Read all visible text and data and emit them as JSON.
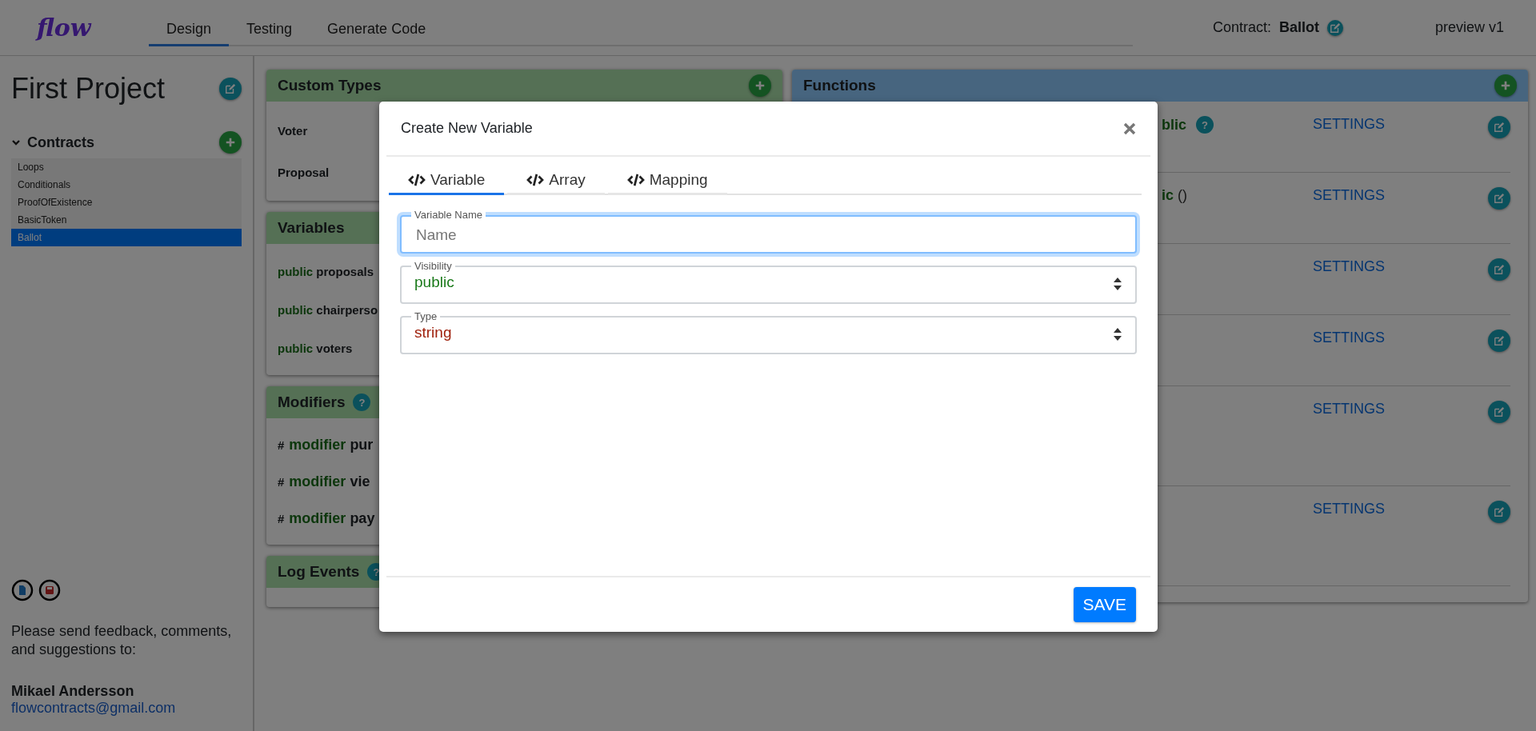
{
  "header": {
    "logo": "flow",
    "tabs": [
      {
        "label": "Design",
        "selected": true
      },
      {
        "label": "Testing",
        "selected": false
      },
      {
        "label": "Generate Code",
        "selected": false
      }
    ],
    "contract_label": "Contract:",
    "contract_name": "Ballot",
    "version": "preview v1"
  },
  "sidebar": {
    "project_title": "First Project",
    "contracts": {
      "title": "Contracts",
      "expanded": true,
      "items": [
        {
          "label": "Loops",
          "selected": false
        },
        {
          "label": "Conditionals",
          "selected": false
        },
        {
          "label": "ProofOfExistence",
          "selected": false
        },
        {
          "label": "BasicToken",
          "selected": false
        },
        {
          "label": "Ballot",
          "selected": true
        }
      ]
    },
    "feedback_text": "Please send feedback, comments, and suggestions to:",
    "author": "Mikael Andersson",
    "email": "flowcontracts@gmail.com"
  },
  "custom_types": {
    "title": "Custom Types",
    "items": [
      "Voter",
      "Proposal"
    ]
  },
  "variables": {
    "title": "Variables",
    "items": [
      {
        "visibility": "public",
        "name": "proposals"
      },
      {
        "visibility": "public",
        "name": "chairperso"
      },
      {
        "visibility": "public",
        "name": "voters"
      }
    ]
  },
  "modifiers": {
    "title": "Modifiers",
    "help": "?",
    "items": [
      {
        "mark": "#",
        "keyword": "modifier",
        "name": "pur"
      },
      {
        "mark": "#",
        "keyword": "modifier",
        "name": "vie"
      },
      {
        "mark": "#",
        "keyword": "modifier",
        "name": "pay"
      }
    ]
  },
  "log_events": {
    "title": "Log Events",
    "help": "?"
  },
  "functions": {
    "title": "Functions",
    "rows": [
      {
        "keyword": "blic",
        "help": "?",
        "action": "SETTINGS"
      },
      {
        "keyword": "ic",
        "params": "()",
        "action": "SETTINGS"
      },
      {
        "action": "SETTINGS"
      },
      {
        "action": "SETTINGS"
      },
      {
        "action": "SETTINGS"
      },
      {
        "action": "SETTINGS"
      }
    ]
  },
  "modal": {
    "title": "Create New Variable",
    "tabs": [
      {
        "label": "Variable",
        "selected": true
      },
      {
        "label": "Array",
        "selected": false
      },
      {
        "label": "Mapping",
        "selected": false
      }
    ],
    "fields": [
      {
        "kind": "input",
        "label": "Variable Name",
        "placeholder": "Name",
        "focused": true
      },
      {
        "kind": "select",
        "label": "Visibility",
        "value": "public",
        "color": "#1b7a1b"
      },
      {
        "kind": "select",
        "label": "Type",
        "value": "string",
        "color": "#a0220e"
      }
    ],
    "save": "SAVE"
  }
}
